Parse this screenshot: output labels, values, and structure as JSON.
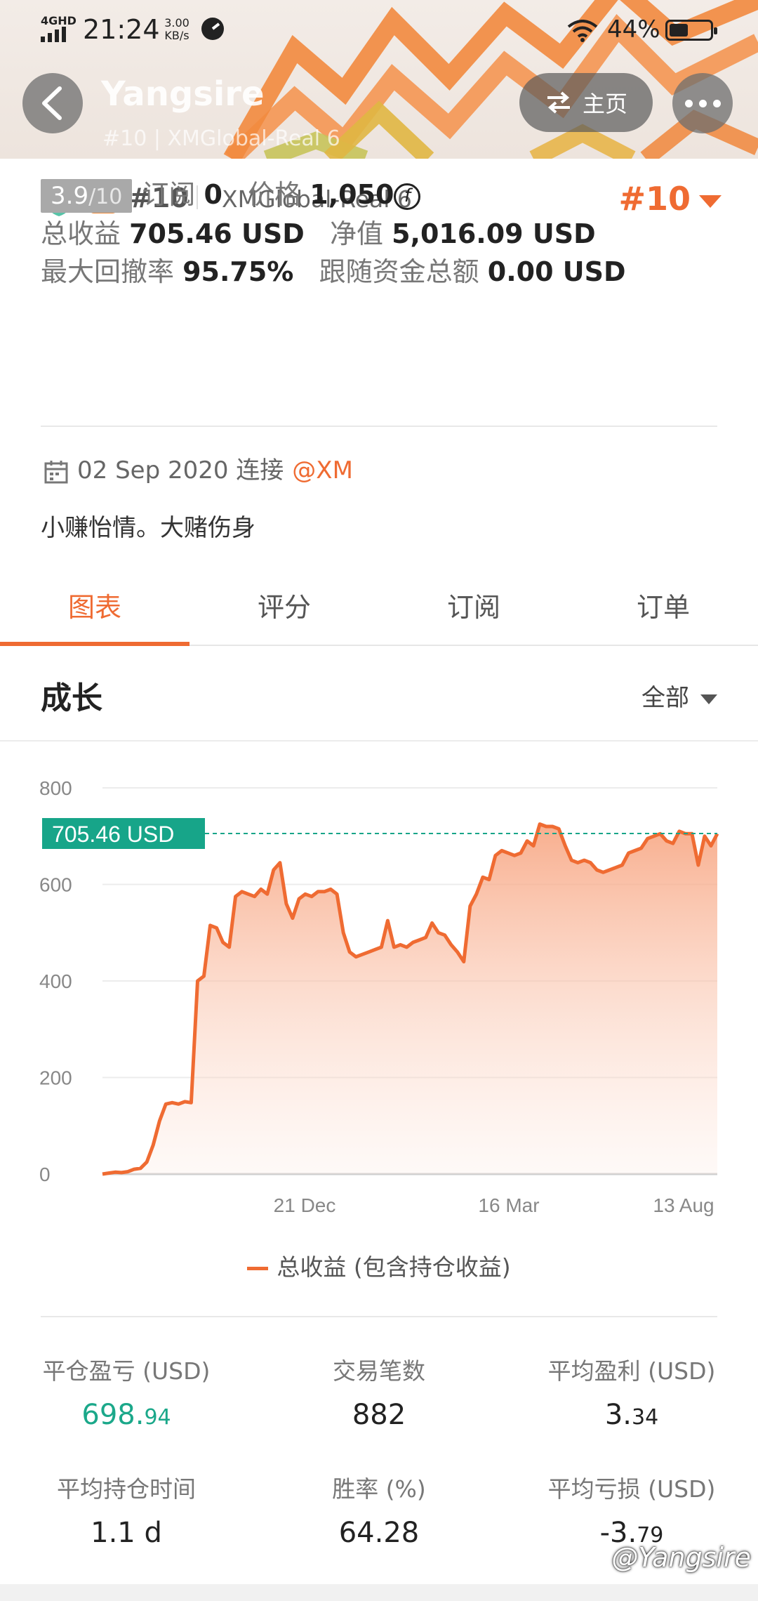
{
  "status_bar": {
    "network": "4GHD",
    "time": "21:24",
    "speed": "3.00 KB/s",
    "battery": "44%"
  },
  "header": {
    "name": "Yangsire",
    "subtitle": "#10 | XMGlobal-Real 6",
    "home_label": "主页"
  },
  "account": {
    "rank": "#10",
    "server": "XMGlobal-Real 6",
    "rank_right": "#10"
  },
  "stats": {
    "score": "3.9",
    "score_max": "/10",
    "subscribe_label": "订阅",
    "subscribe_value": "0",
    "price_label": "价格",
    "price_value": "1,050",
    "price_icon": "f",
    "total_profit_label": "总收益",
    "total_profit_value": "705.46 USD",
    "equity_label": "净值",
    "equity_value": "5,016.09 USD",
    "drawdown_label": "最大回撤率",
    "drawdown_value": "95.75%",
    "follow_label": "跟随资金总额",
    "follow_value": "0.00 USD"
  },
  "connect": {
    "date": "02 Sep 2020 连接",
    "broker": "@XM"
  },
  "bio": "小赚怡情。大赌伤身",
  "tabs": [
    "图表",
    "评分",
    "订阅",
    "订单"
  ],
  "section": {
    "title": "成长",
    "filter": "全部"
  },
  "chart_data": {
    "type": "area",
    "ylim": [
      0,
      800
    ],
    "y_ticks": [
      "800",
      "600",
      "400",
      "200",
      "0"
    ],
    "x_tick_labels": [
      "21 Dec",
      "16 Mar",
      "13 Aug"
    ],
    "current_label": "705.46 USD",
    "current_value": 705.46,
    "series": [
      {
        "name": "总收益 (包含持仓收益)",
        "values": [
          0,
          2,
          4,
          3,
          5,
          10,
          12,
          25,
          60,
          110,
          145,
          148,
          145,
          150,
          148,
          400,
          410,
          515,
          510,
          480,
          470,
          575,
          585,
          580,
          575,
          590,
          580,
          630,
          645,
          560,
          530,
          570,
          580,
          575,
          585,
          585,
          590,
          580,
          500,
          460,
          450,
          455,
          460,
          465,
          470,
          525,
          470,
          475,
          470,
          480,
          485,
          490,
          520,
          500,
          495,
          475,
          460,
          440,
          555,
          580,
          615,
          610,
          660,
          670,
          665,
          660,
          665,
          690,
          680,
          725,
          720,
          720,
          715,
          680,
          650,
          645,
          650,
          645,
          630,
          625,
          630,
          635,
          640,
          665,
          670,
          675,
          695,
          700,
          705,
          690,
          685,
          710,
          705,
          705,
          640,
          700,
          680,
          705
        ]
      }
    ],
    "legend_label": "总收益 (包含持仓收益)"
  },
  "metrics": [
    {
      "label": "平仓盈亏 (USD)",
      "value": "698.",
      "dec": "94",
      "color": "green"
    },
    {
      "label": "交易笔数",
      "value": "882",
      "dec": "",
      "color": ""
    },
    {
      "label": "平均盈利 (USD)",
      "value": "3.",
      "dec": "34",
      "color": ""
    },
    {
      "label": "平均持仓时间",
      "value": "1.1 d",
      "dec": "",
      "color": ""
    },
    {
      "label": "胜率 (%)",
      "value": "64.28",
      "dec": "",
      "color": ""
    },
    {
      "label": "平均亏损 (USD)",
      "value": "-3.",
      "dec": "79",
      "color": ""
    }
  ],
  "watermark": "@Yangsire",
  "colors": {
    "accent": "#ef6b32",
    "green": "#1ba88a",
    "label_green": "#17a589"
  }
}
